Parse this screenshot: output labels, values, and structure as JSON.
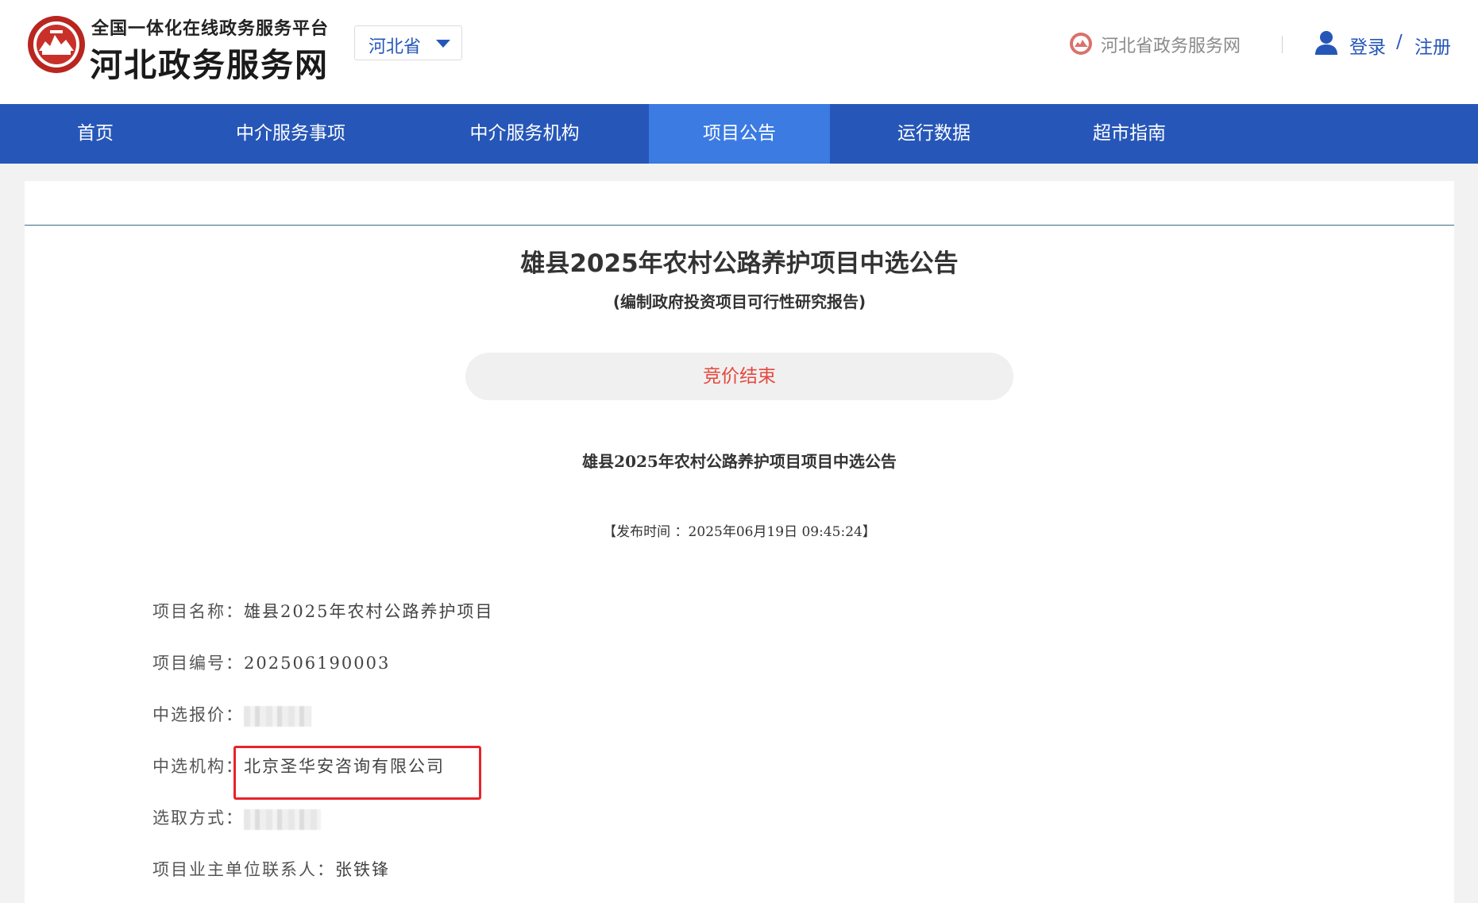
{
  "header": {
    "logo_small": "全国一体化在线政务服务平台",
    "logo_big": "河北政务服务网",
    "region": "河北省",
    "portal_link": "河北省政务服务网",
    "login": "登录",
    "slash": "/",
    "register": "注册"
  },
  "nav": {
    "items": [
      {
        "label": "首页"
      },
      {
        "label": "中介服务事项"
      },
      {
        "label": "中介服务机构"
      },
      {
        "label": "项目公告"
      },
      {
        "label": "运行数据"
      },
      {
        "label": "超市指南"
      }
    ],
    "active": "项目公告"
  },
  "announcement": {
    "title": "雄县2025年农村公路养护项目中选公告",
    "subtitle": "(编制政府投资项目可行性研究报告)",
    "status": "竞价结束",
    "heading": "雄县2025年农村公路养护项目项目中选公告",
    "publish_time": "【发布时间 ：2025年06月19日 09:45:24】",
    "fields": [
      {
        "label": "项目名称：",
        "value": "雄县2025年农村公路养护项目"
      },
      {
        "label": "项目编号：",
        "value": "202506190003"
      },
      {
        "label": "中选报价：",
        "value": ""
      },
      {
        "label": "中选机构：",
        "value": "北京圣华安咨询有限公司"
      },
      {
        "label": "选取方式：",
        "value": ""
      },
      {
        "label": "项目业主单位联系人：",
        "value": "张铁锋"
      }
    ]
  },
  "colors": {
    "nav_bg": "#2657b8",
    "nav_active": "#3b7be2",
    "status_text": "#e5483e",
    "highlight": "#e8232a"
  }
}
